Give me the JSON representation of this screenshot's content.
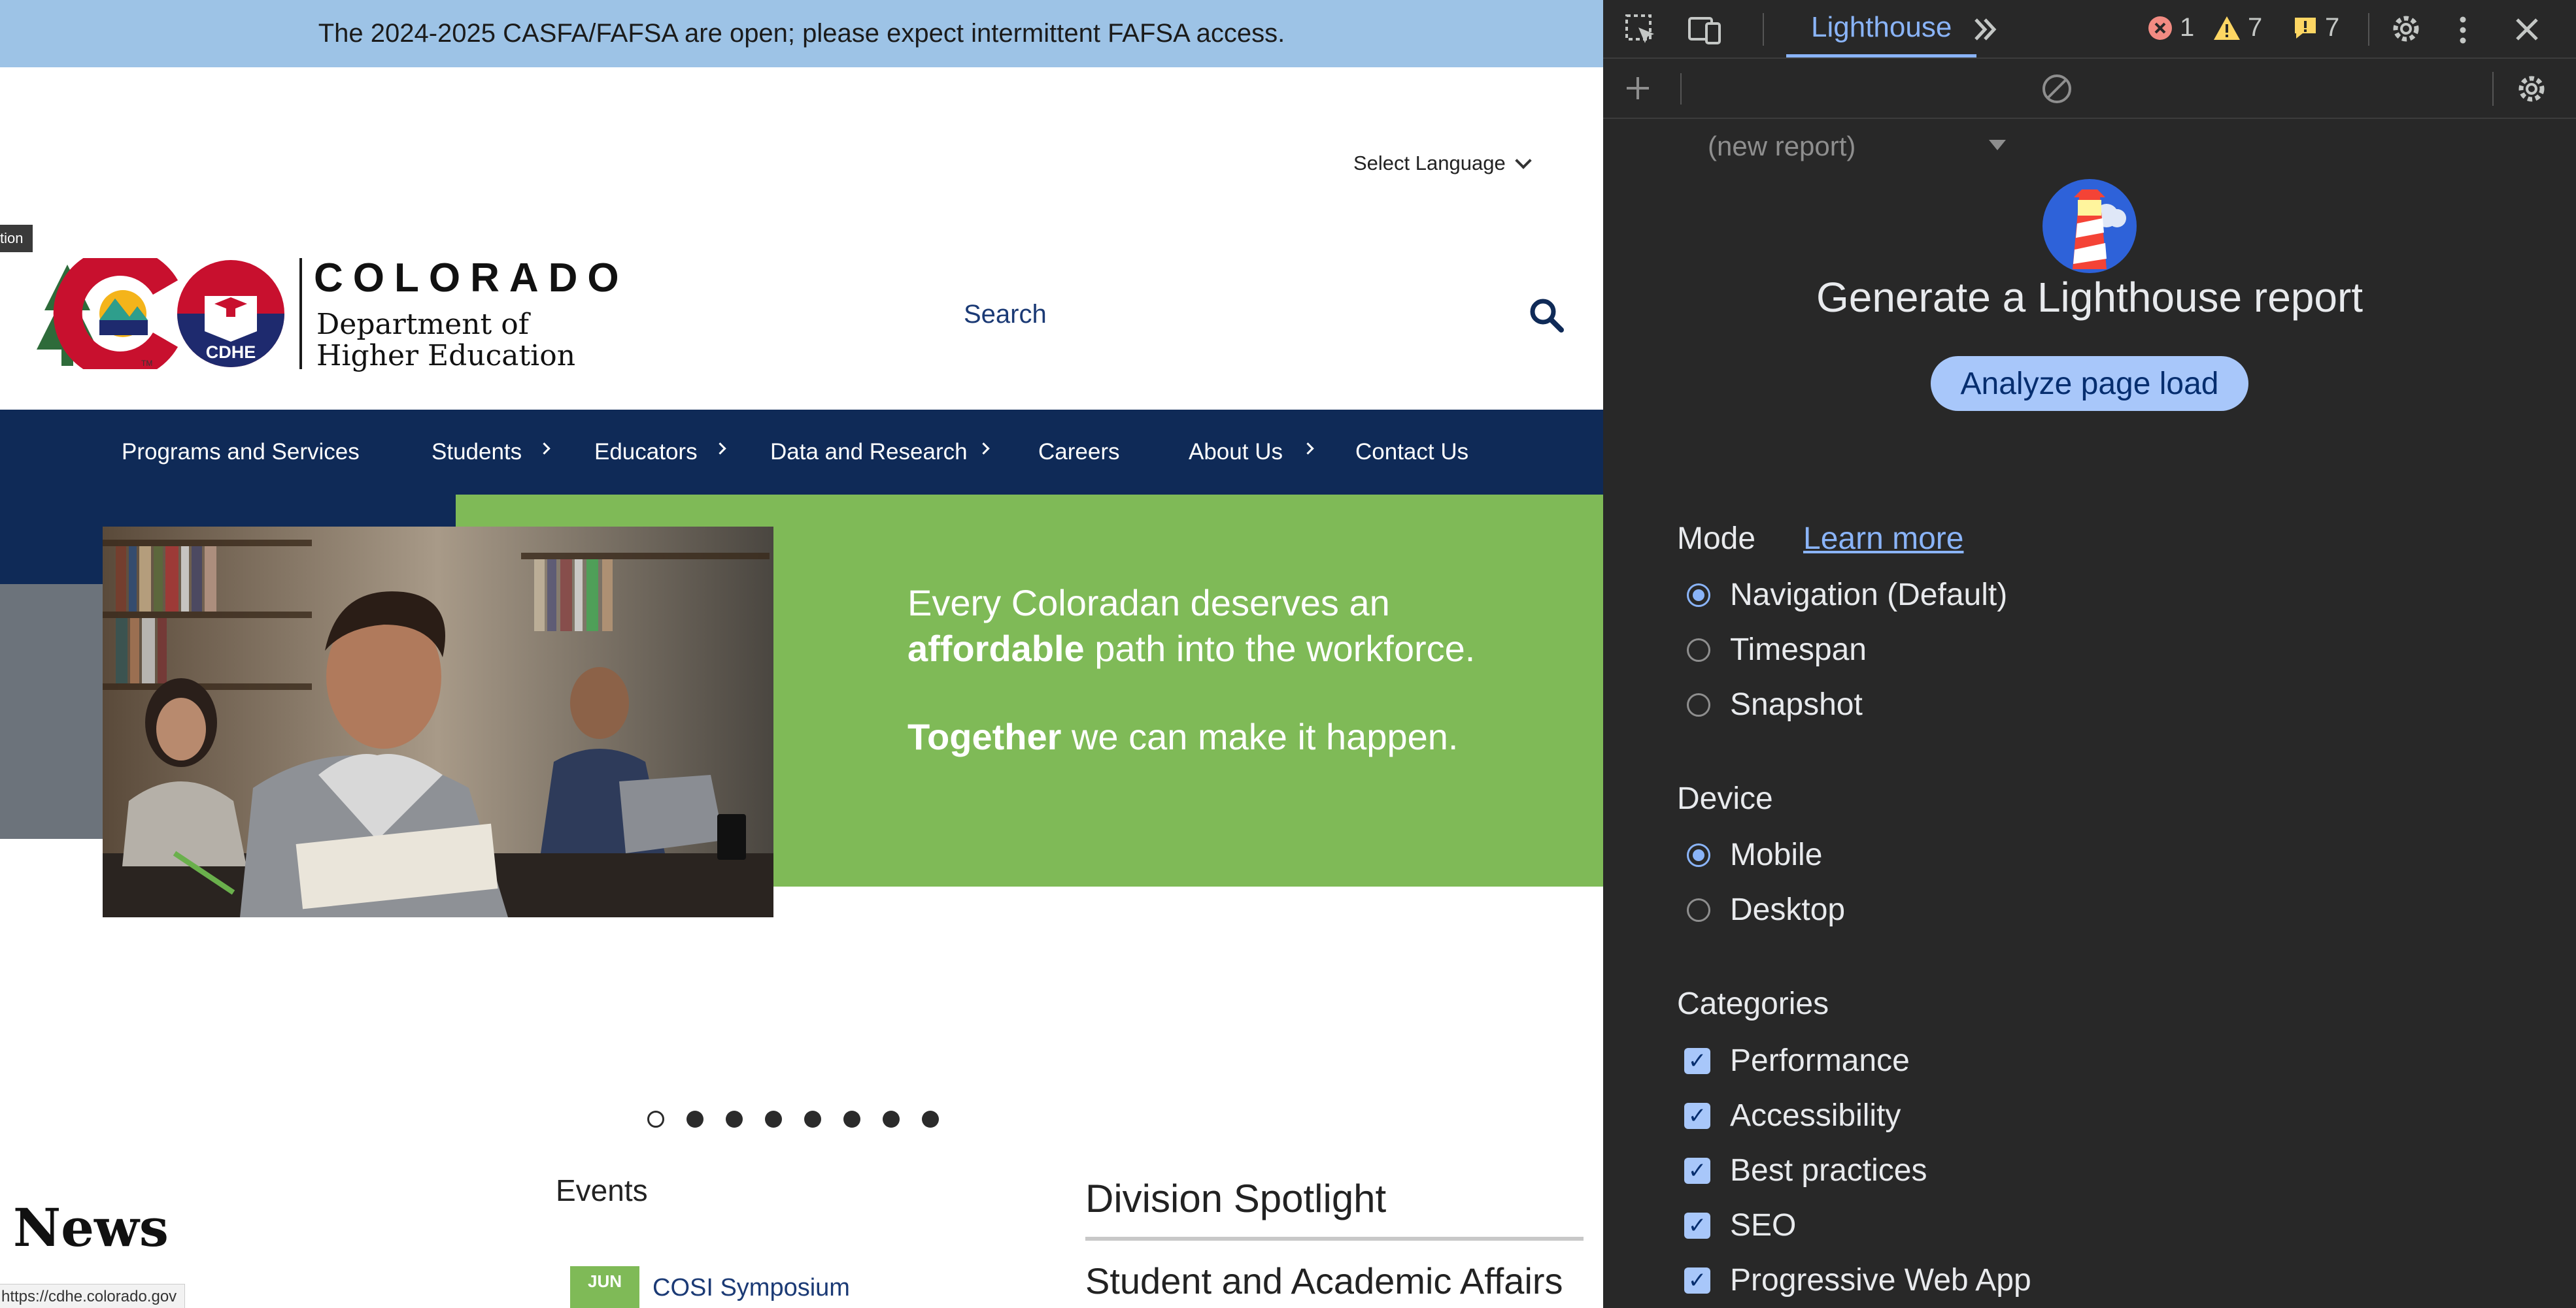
{
  "banner": {
    "text": "The 2024-2025 CASFA/FAFSA are open; please expect intermittent FAFSA access."
  },
  "language": {
    "label": "Select Language"
  },
  "tooltip_stub": "tion",
  "logo": {
    "state": "COLORADO",
    "dept_line1": "Department of",
    "dept_line2": "Higher Education",
    "badge": "CDHE",
    "tm": "TM"
  },
  "search": {
    "label": "Search"
  },
  "nav": {
    "items": [
      {
        "label": "Programs and Services"
      },
      {
        "label": "Students"
      },
      {
        "label": "Educators"
      },
      {
        "label": "Data and Research"
      },
      {
        "label": "Careers"
      },
      {
        "label": "About Us"
      },
      {
        "label": "Contact Us"
      }
    ]
  },
  "hero": {
    "line1": "Every Coloradan deserves an",
    "line2_bold": "affordable",
    "line2_rest": " path into the workforce.",
    "line3_bold": "Together",
    "line3_rest": " we can make it happen."
  },
  "carousel": {
    "slides": 8,
    "active": 1
  },
  "news": {
    "title": "News"
  },
  "events": {
    "title": "Events",
    "date_month": "JUN",
    "first_title": "COSI Symposium"
  },
  "spotlight": {
    "title": "Division Spotlight",
    "subtitle": "Student and Academic Affairs"
  },
  "status_url": "https://cdhe.colorado.gov",
  "devtools": {
    "tab": "Lighthouse",
    "errors": "1",
    "warnings": "7",
    "issues": "7",
    "report_select": "(new report)",
    "generate_title": "Generate a Lighthouse report",
    "analyze_button": "Analyze page load",
    "mode": {
      "title": "Mode",
      "learn_more": "Learn more",
      "options": [
        "Navigation (Default)",
        "Timespan",
        "Snapshot"
      ],
      "selected": "Navigation (Default)"
    },
    "device": {
      "title": "Device",
      "options": [
        "Mobile",
        "Desktop"
      ],
      "selected": "Mobile"
    },
    "categories": {
      "title": "Categories",
      "items": [
        "Performance",
        "Accessibility",
        "Best practices",
        "SEO",
        "Progressive Web App"
      ]
    },
    "colors": {
      "accent": "#8ab4f8",
      "button": "#a8c7fa",
      "panel_bg": "#282828"
    }
  }
}
